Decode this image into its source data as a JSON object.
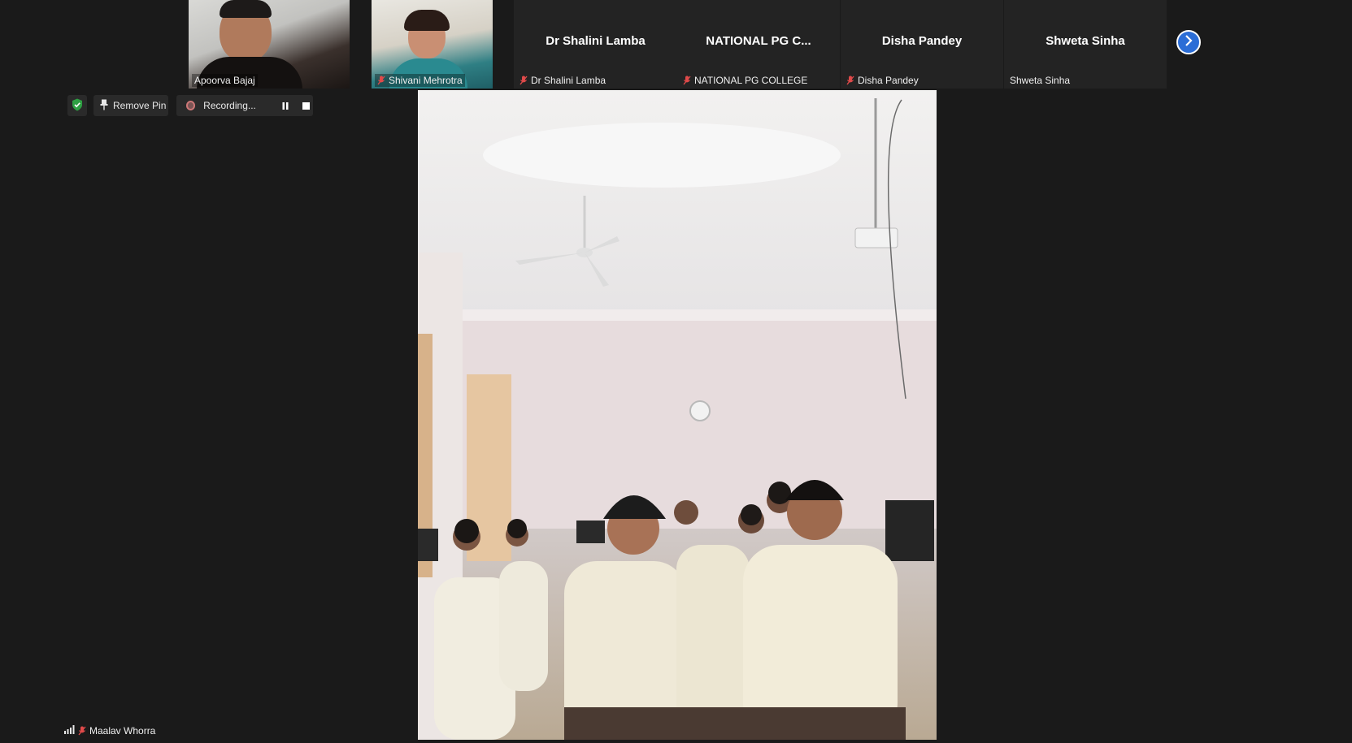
{
  "participants": [
    {
      "display": "",
      "label": "Apoorva Bajaj",
      "muted": false,
      "video": true
    },
    {
      "display": "",
      "label": "Shivani Mehrotra",
      "muted": true,
      "video": true
    },
    {
      "display": "Dr Shalini Lamba",
      "label": "Dr Shalini Lamba",
      "muted": true,
      "video": false
    },
    {
      "display": "NATIONAL PG C...",
      "label": "NATIONAL PG COLLEGE",
      "muted": true,
      "video": false
    },
    {
      "display": "Disha Pandey",
      "label": "Disha Pandey",
      "muted": true,
      "video": false
    },
    {
      "display": "Shweta Sinha",
      "label": "Shweta Sinha",
      "muted": false,
      "video": false
    }
  ],
  "toolbar": {
    "remove_pin_label": "Remove Pin",
    "recording_label": "Recording..."
  },
  "main": {
    "speaker_label": "Maalav Whorra",
    "speaker_muted": true
  },
  "colors": {
    "background": "#1a1a1a",
    "tile": "#232323",
    "accent_blue": "#2b6dd6",
    "security_green": "#2ea043",
    "mute_red": "#e04a4a"
  },
  "icons": [
    "shield-check-icon",
    "pin-icon",
    "record-icon",
    "pause-icon",
    "stop-icon",
    "next-page-icon",
    "mic-muted-icon",
    "signal-icon"
  ]
}
